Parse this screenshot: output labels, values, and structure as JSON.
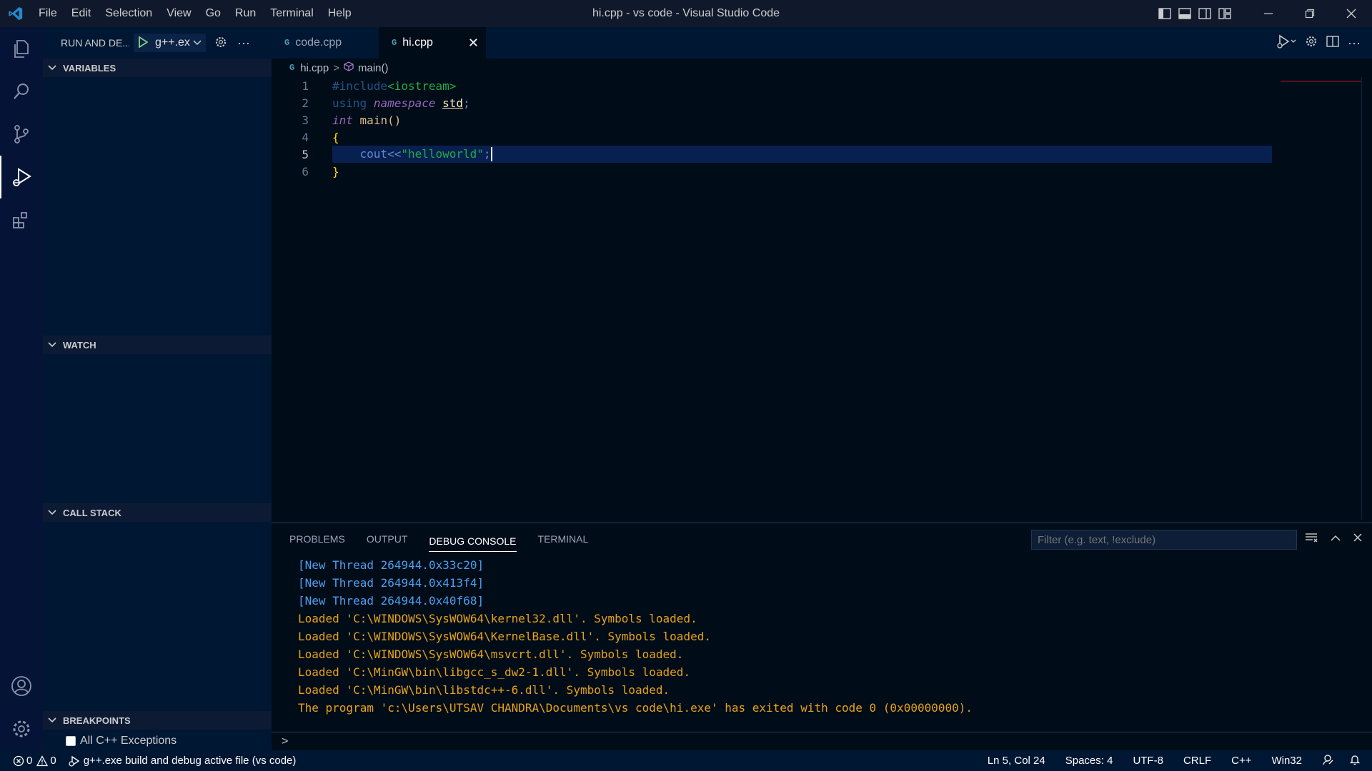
{
  "window": {
    "title": "hi.cpp - vs code - Visual Studio Code",
    "menu": [
      "File",
      "Edit",
      "Selection",
      "View",
      "Go",
      "Run",
      "Terminal",
      "Help"
    ]
  },
  "sidebar": {
    "header_label": "RUN AND DE...",
    "config_label": "g++.ex",
    "sections": {
      "variables": "VARIABLES",
      "watch": "WATCH",
      "call_stack": "CALL STACK",
      "breakpoints": "BREAKPOINTS"
    },
    "breakpoint_items": [
      "All C++ Exceptions"
    ]
  },
  "tabs": [
    {
      "label": "code.cpp",
      "active": false
    },
    {
      "label": "hi.cpp",
      "active": true
    }
  ],
  "breadcrumb": {
    "file": "hi.cpp",
    "symbol": "main()"
  },
  "editor": {
    "line_numbers": [
      "1",
      "2",
      "3",
      "4",
      "5",
      "6"
    ],
    "current_line": 5,
    "lines": [
      "#include<iostream>",
      "using namespace std;",
      "int main()",
      "{",
      "    cout<<\"helloworld\";",
      "}"
    ]
  },
  "panel": {
    "tabs": [
      "PROBLEMS",
      "OUTPUT",
      "DEBUG CONSOLE",
      "TERMINAL"
    ],
    "active_tab": "DEBUG CONSOLE",
    "filter_placeholder": "Filter (e.g. text, !exclude)",
    "console_lines": [
      "[New Thread 264944.0x33c20]",
      "[New Thread 264944.0x413f4]",
      "[New Thread 264944.0x40f68]",
      "Loaded 'C:\\WINDOWS\\SysWOW64\\kernel32.dll'. Symbols loaded.",
      "Loaded 'C:\\WINDOWS\\SysWOW64\\KernelBase.dll'. Symbols loaded.",
      "Loaded 'C:\\WINDOWS\\SysWOW64\\msvcrt.dll'. Symbols loaded.",
      "Loaded 'C:\\MinGW\\bin\\libgcc_s_dw2-1.dll'. Symbols loaded.",
      "Loaded 'C:\\MinGW\\bin\\libstdc++-6.dll'. Symbols loaded.",
      "The program 'c:\\Users\\UTSAV CHANDRA\\Documents\\vs code\\hi.exe' has exited with code 0 (0x00000000)."
    ],
    "prompt": ">"
  },
  "statusbar": {
    "errors": "0",
    "warnings": "0",
    "launch": "g++.exe build and debug active file (vs code)",
    "position": "Ln 5, Col 24",
    "spaces": "Spaces: 4",
    "encoding": "UTF-8",
    "eol": "CRLF",
    "language": "C++",
    "platform": "Win32"
  },
  "colors": {
    "background": "#000c18",
    "activitybar": "#051336",
    "sidebar": "#001733",
    "current_line": "#082050",
    "run_green": "#89d185"
  }
}
